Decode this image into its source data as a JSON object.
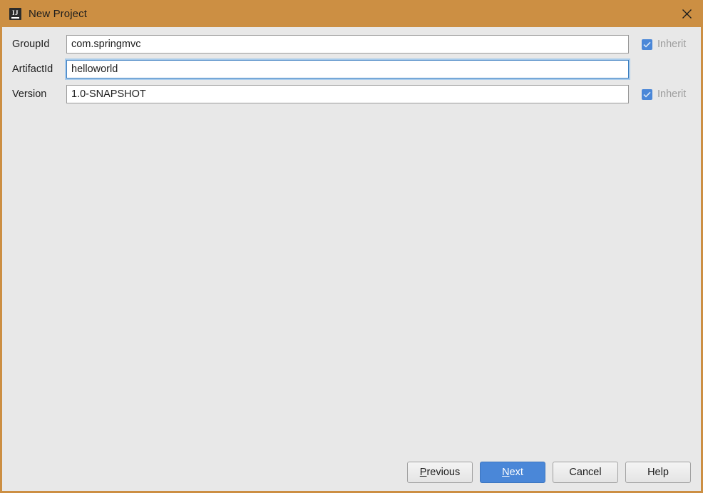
{
  "window": {
    "title": "New Project",
    "app_icon": "intellij-idea-icon",
    "icon_letters": "IJ",
    "close_icon": "close-icon",
    "titlebar_color": "#cc8f43",
    "background_color": "#e8e8e8"
  },
  "form": {
    "fields": [
      {
        "label": "GroupId",
        "value": "com.springmvc",
        "focused": false,
        "inherit": {
          "label": "Inherit",
          "checked": true,
          "enabled": false
        }
      },
      {
        "label": "ArtifactId",
        "value": "helloworld",
        "focused": true,
        "inherit": null
      },
      {
        "label": "Version",
        "value": "1.0-SNAPSHOT",
        "focused": false,
        "inherit": {
          "label": "Inherit",
          "checked": true,
          "enabled": false
        }
      }
    ]
  },
  "buttons": {
    "previous": {
      "label": "Previous",
      "mnemonic": "P",
      "rest": "revious",
      "default": false
    },
    "next": {
      "label": "Next",
      "mnemonic": "N",
      "rest": "ext",
      "default": true
    },
    "cancel": {
      "label": "Cancel",
      "default": false
    },
    "help": {
      "label": "Help",
      "default": false
    }
  },
  "colors": {
    "accent": "#4a87d8",
    "titlebar": "#cc8f43",
    "focus_border": "#3d7fc1",
    "disabled_text": "#9e9e9e"
  }
}
